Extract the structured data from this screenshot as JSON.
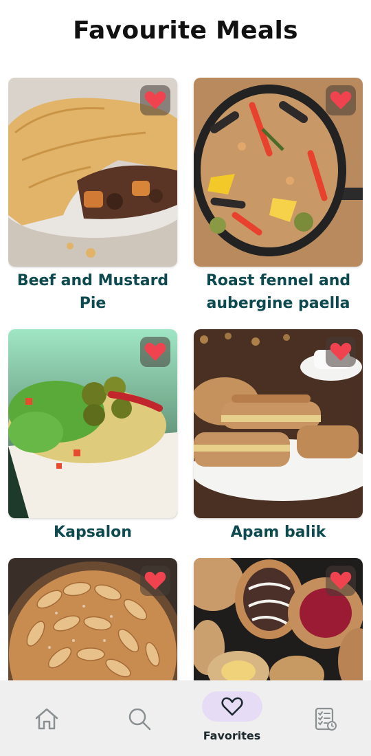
{
  "header": {
    "title": "Favourite Meals"
  },
  "meals": [
    {
      "title": "Beef and Mustard Pie",
      "favorite": true,
      "icon": "heart-icon"
    },
    {
      "title": "Roast fennel and aubergine paella",
      "favorite": true,
      "icon": "heart-icon"
    },
    {
      "title": "Kapsalon",
      "favorite": true,
      "icon": "heart-icon"
    },
    {
      "title": "Apam balik",
      "favorite": true,
      "icon": "heart-icon"
    },
    {
      "title": "",
      "favorite": true,
      "icon": "heart-icon"
    },
    {
      "title": "",
      "favorite": true,
      "icon": "heart-icon"
    }
  ],
  "bottom_nav": {
    "items": [
      {
        "icon": "home-icon",
        "label": ""
      },
      {
        "icon": "search-icon",
        "label": ""
      },
      {
        "icon": "heart-outline-icon",
        "label": "Favorites",
        "active": true
      },
      {
        "icon": "checklist-icon",
        "label": ""
      }
    ]
  },
  "colors": {
    "title_text": "#0d4a4f",
    "heart": "#f0434f",
    "active_pill": "#e6dcf5",
    "nav_background": "#f0efef"
  }
}
